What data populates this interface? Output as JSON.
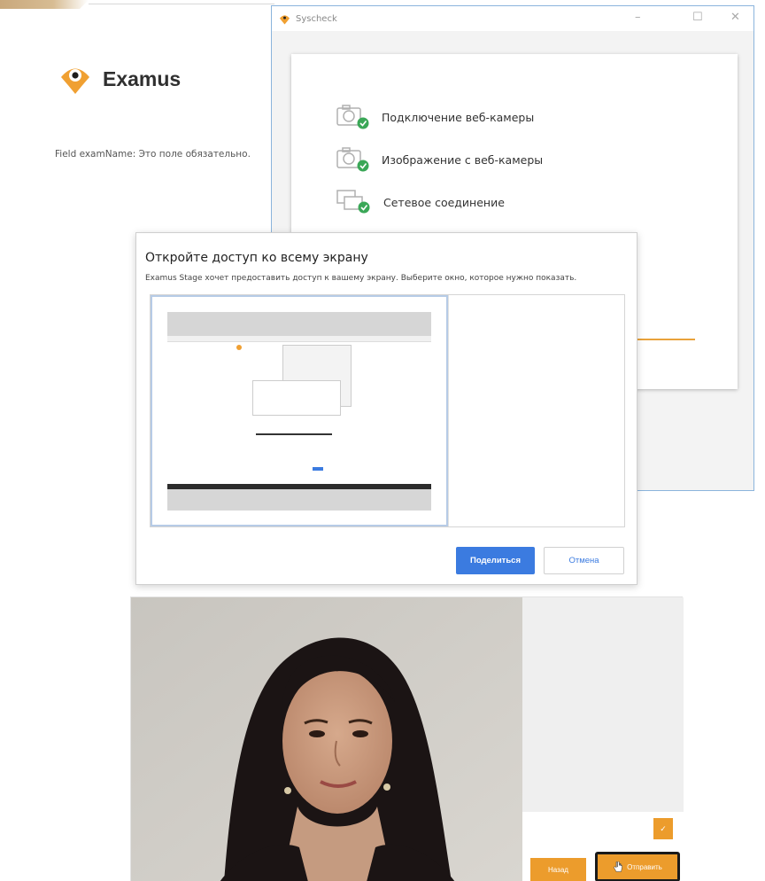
{
  "examus": {
    "logo_text": "Examus",
    "field_error": "Field examName: Это поле обязательно."
  },
  "syscheck": {
    "title": "Syscheck",
    "controls": {
      "minimize": "–",
      "maximize": "☐",
      "close": "✕"
    },
    "checks": [
      {
        "label": "Подключение веб-камеры",
        "icon": "camera-check-icon"
      },
      {
        "label": "Изображение с веб-камеры",
        "icon": "camera-check-icon"
      },
      {
        "label": "Сетевое соединение",
        "icon": "network-check-icon"
      }
    ]
  },
  "share_dialog": {
    "title": "Откройте доступ ко всему экрану",
    "description": "Examus Stage хочет предоставить доступ к вашему экрану. Выберите окно, которое нужно показать.",
    "share_button": "Поделиться",
    "cancel_button": "Отмена"
  },
  "webcam_panel": {
    "small_button": "✓",
    "back_button": "Назад",
    "send_button": "Отправить"
  },
  "colors": {
    "accent_orange": "#ec9c2c",
    "primary_blue": "#3b7be0",
    "check_green": "#3aa757",
    "window_border": "#8bb4dc"
  }
}
